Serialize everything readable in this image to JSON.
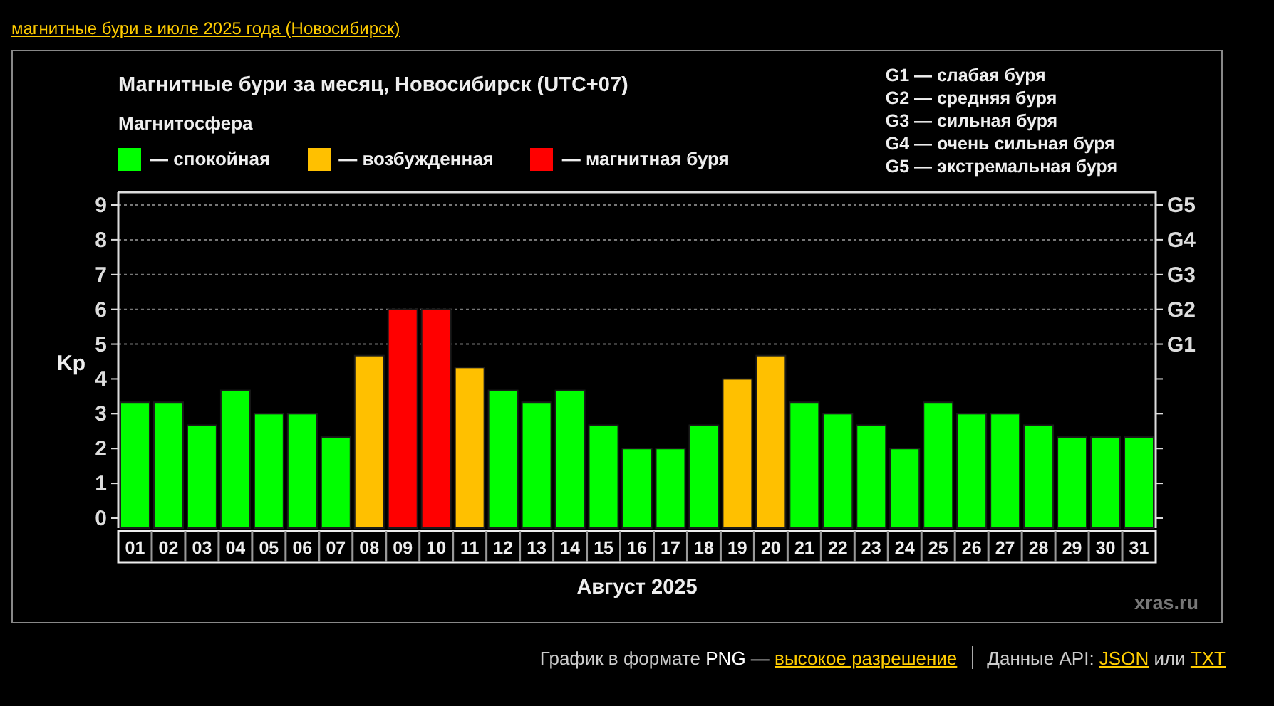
{
  "top_link": "магнитные бури в июле 2025 года (Новосибирск)",
  "chart": {
    "title": "Магнитные бури за месяц, Новосибирск (UTC+07)",
    "subheading": "Магнитосфера",
    "legend_dash": "—",
    "g_scale": [
      "G1 — слабая буря",
      "G2 — средняя буря",
      "G3 — сильная буря",
      "G4 — очень сильная буря",
      "G5 — экстремальная буря"
    ],
    "g_axis_labels": [
      "G5",
      "G4",
      "G3",
      "G2",
      "G1"
    ],
    "credit": "xras.ru",
    "chart_data": {
      "type": "bar",
      "stacked": true,
      "grid": true,
      "xlabel": "Август 2025",
      "ylabel": "Kp",
      "ylim": [
        0,
        9
      ],
      "yticks": [
        0,
        1,
        2,
        3,
        4,
        5,
        6,
        7,
        8,
        9
      ],
      "categories": [
        "01",
        "02",
        "03",
        "04",
        "05",
        "06",
        "07",
        "08",
        "09",
        "10",
        "11",
        "12",
        "13",
        "14",
        "15",
        "16",
        "17",
        "18",
        "19",
        "20",
        "21",
        "22",
        "23",
        "24",
        "25",
        "26",
        "27",
        "28",
        "29",
        "30",
        "31"
      ],
      "series": [
        {
          "name": "спокойная",
          "color": "#00ff00",
          "values": [
            3.33,
            3.33,
            2.67,
            3.67,
            3,
            3,
            2.33,
            null,
            null,
            null,
            null,
            3.67,
            3.33,
            3.67,
            2.67,
            2,
            2,
            2.67,
            null,
            null,
            3.33,
            3,
            2.67,
            2,
            3.33,
            3,
            3,
            2.67,
            2.33,
            2.33,
            2.33
          ]
        },
        {
          "name": "возбужденная",
          "color": "#ffc000",
          "values": [
            null,
            null,
            null,
            null,
            null,
            null,
            null,
            4.67,
            null,
            null,
            4.33,
            null,
            null,
            null,
            null,
            null,
            null,
            null,
            4,
            4.67,
            null,
            null,
            null,
            null,
            null,
            null,
            null,
            null,
            null,
            null,
            null
          ]
        },
        {
          "name": "магнитная буря",
          "color": "#ff0000",
          "values": [
            null,
            null,
            null,
            null,
            null,
            null,
            null,
            null,
            6,
            6,
            null,
            null,
            null,
            null,
            null,
            null,
            null,
            null,
            null,
            null,
            null,
            null,
            null,
            null,
            null,
            null,
            null,
            null,
            null,
            null,
            null
          ]
        }
      ]
    }
  },
  "footer": {
    "png_text": "График в формате",
    "png_format": "PNG",
    "dash": "—",
    "png_link": "высокое разрешение",
    "api_text": "Данные API:",
    "json_link": "JSON",
    "or_text": "или",
    "txt_link": "TXT"
  }
}
